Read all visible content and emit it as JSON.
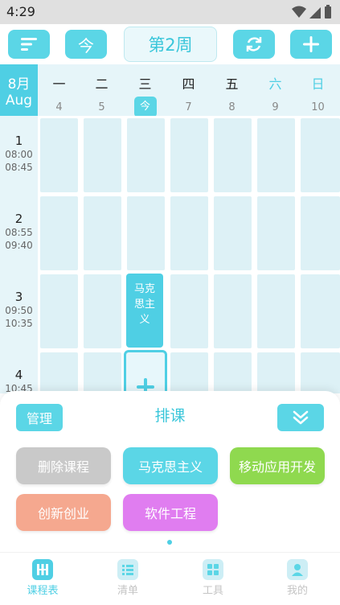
{
  "status_bar": {
    "time": "4:29"
  },
  "toolbar": {
    "menu_icon": "menu-lines-icon",
    "today_label": "今",
    "week_label": "第2周",
    "refresh_icon": "refresh-icon",
    "add_icon": "plus-icon"
  },
  "month": {
    "cn": "8月",
    "en": "Aug"
  },
  "days": [
    {
      "name": "一",
      "date": "4"
    },
    {
      "name": "二",
      "date": "5"
    },
    {
      "name": "三",
      "date": "今"
    },
    {
      "name": "四",
      "date": "7"
    },
    {
      "name": "五",
      "date": "8"
    },
    {
      "name": "六",
      "date": "9"
    },
    {
      "name": "日",
      "date": "10"
    }
  ],
  "periods": [
    {
      "num": "1",
      "start": "08:00",
      "end": "08:45"
    },
    {
      "num": "2",
      "start": "08:55",
      "end": "09:40"
    },
    {
      "num": "3",
      "start": "09:50",
      "end": "10:35"
    },
    {
      "num": "4",
      "start": "10:45",
      "end": ""
    }
  ],
  "schedule": [
    {
      "course": "马克思主义",
      "day_index": 2,
      "period_index": 2
    }
  ],
  "sheet": {
    "title": "排课",
    "manage_label": "管理",
    "collapse_icon": "chevron-double-down-icon",
    "chips": [
      {
        "label": "删除课程",
        "color": "#c9c9c9"
      },
      {
        "label": "马克思主义",
        "color": "#5bd6e6"
      },
      {
        "label": "移动应用开发",
        "color": "#8fd94f"
      },
      {
        "label": "创新创业",
        "color": "#f5a88f"
      },
      {
        "label": "软件工程",
        "color": "#e07df0"
      }
    ]
  },
  "bottom_nav": [
    {
      "label": "课程表",
      "icon": "timetable-icon",
      "active": true
    },
    {
      "label": "清单",
      "icon": "list-icon",
      "active": false
    },
    {
      "label": "工具",
      "icon": "tools-grid-icon",
      "active": false
    },
    {
      "label": "我的",
      "icon": "profile-icon",
      "active": false
    }
  ],
  "colors": {
    "accent": "#4fcfe4",
    "cell": "#ddf1f6"
  }
}
